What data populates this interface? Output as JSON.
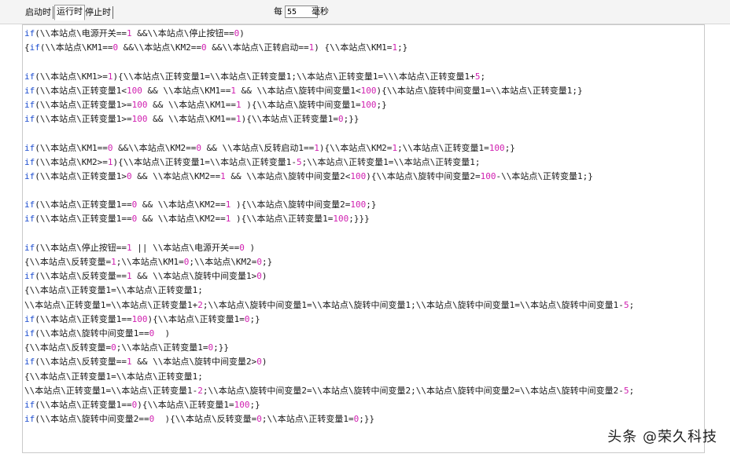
{
  "tabs": [
    {
      "label": "启动时",
      "active": false
    },
    {
      "label": "运行时",
      "active": true
    },
    {
      "label": "停止时",
      "active": false
    }
  ],
  "rate": {
    "prefix": "每",
    "value": "55",
    "unit": "毫秒"
  },
  "code_lines": [
    "if(\\\\本站点\\电源开关==1 &&\\\\本站点\\停止按钮==0)",
    "{if(\\\\本站点\\KM1==0 &&\\\\本站点\\KM2==0 &&\\\\本站点\\正转启动==1) {\\\\本站点\\KM1=1;}",
    "",
    "if(\\\\本站点\\KM1>=1){\\\\本站点\\正转变量1=\\\\本站点\\正转变量1;\\\\本站点\\正转变量1=\\\\\\本站点\\正转变量1+5;",
    "if(\\\\本站点\\正转变量1<100 && \\\\本站点\\KM1==1 && \\\\本站点\\旋转中间变量1<100){\\\\本站点\\旋转中间变量1=\\\\本站点\\正转变量1;}",
    "if(\\\\本站点\\正转变量1>=100 && \\\\本站点\\KM1==1 ){\\\\本站点\\旋转中间变量1=100;}",
    "if(\\\\本站点\\正转变量1>=100 && \\\\本站点\\KM1==1){\\\\本站点\\正转变量1=0;}}",
    "",
    "if(\\\\本站点\\KM1==0 &&\\\\本站点\\KM2==0 && \\\\本站点\\反转启动1==1){\\\\本站点\\KM2=1;\\\\本站点\\正转变量1=100;}",
    "if(\\\\本站点\\KM2>=1){\\\\本站点\\正转变量1=\\\\本站点\\正转变量1-5;\\\\本站点\\正转变量1=\\\\本站点\\正转变量1;",
    "if(\\\\本站点\\正转变量1>0 && \\\\本站点\\KM2==1 && \\\\本站点\\旋转中间变量2<100){\\\\本站点\\旋转中间变量2=100-\\\\本站点\\正转变量1;}",
    "",
    "if(\\\\本站点\\正转变量1==0 && \\\\本站点\\KM2==1 ){\\\\本站点\\旋转中间变量2=100;}",
    "if(\\\\本站点\\正转变量1==0 && \\\\本站点\\KM2==1 ){\\\\本站点\\正转变量1=100;}}}",
    "",
    "if(\\\\本站点\\停止按钮==1 || \\\\本站点\\电源开关==0 )",
    "{\\\\本站点\\反转变量=1;\\\\本站点\\KM1=0;\\\\本站点\\KM2=0;}",
    "if(\\\\本站点\\反转变量==1 && \\\\本站点\\旋转中间变量1>0)",
    "{\\\\本站点\\正转变量1=\\\\本站点\\正转变量1;",
    "\\\\本站点\\正转变量1=\\\\本站点\\正转变量1+2;\\\\本站点\\旋转中间变量1=\\\\本站点\\旋转中间变量1;\\\\本站点\\旋转中间变量1=\\\\本站点\\旋转中间变量1-5;",
    "if(\\\\本站点\\正转变量1==100){\\\\本站点\\正转变量1=0;}",
    "if(\\\\本站点\\旋转中间变量1==0  )",
    "{\\\\本站点\\反转变量=0;\\\\本站点\\正转变量1=0;}}",
    "if(\\\\本站点\\反转变量==1 && \\\\本站点\\旋转中间变量2>0)",
    "{\\\\本站点\\正转变量1=\\\\本站点\\正转变量1;",
    "\\\\本站点\\正转变量1=\\\\本站点\\正转变量1-2;\\\\本站点\\旋转中间变量2=\\\\本站点\\旋转中间变量2;\\\\本站点\\旋转中间变量2=\\\\本站点\\旋转中间变量2-5;",
    "if(\\\\本站点\\正转变量1==0){\\\\本站点\\正转变量1=100;}",
    "if(\\\\本站点\\旋转中间变量2==0  ){\\\\本站点\\反转变量=0;\\\\本站点\\正转变量1=0;}}"
  ],
  "watermark": "头条 @荣久科技",
  "colors": {
    "keyword": "#1f4fd0",
    "number": "#d01fb0",
    "text": "#1a1a1a"
  }
}
